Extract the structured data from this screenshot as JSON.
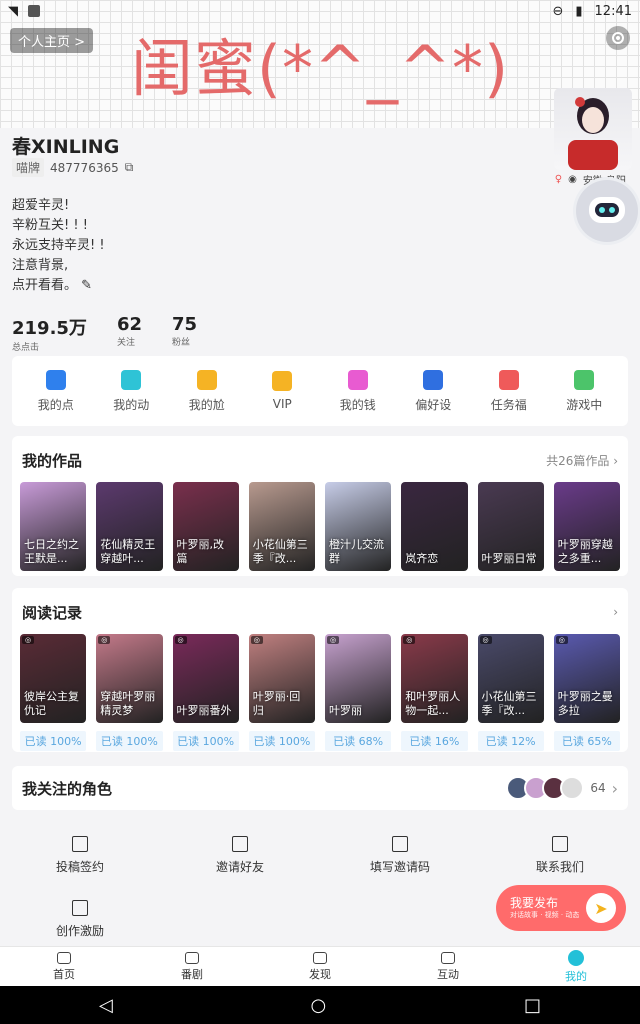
{
  "status": {
    "time": "12:41"
  },
  "banner": {
    "title": "闺蜜(*^_^*)",
    "home_label": "个人主页 >"
  },
  "profile": {
    "name": "春XINLING",
    "tag": "喵牌",
    "id": "487776365",
    "location": "安徽 阜阳",
    "bio": [
      "超爱辛灵!",
      "辛粉互关! ! !",
      "永远支持辛灵! !",
      "注意背景,",
      "点开看看。"
    ]
  },
  "stats": [
    {
      "value": "219.5万",
      "label": "总点击"
    },
    {
      "value": "62",
      "label": "关注"
    },
    {
      "value": "75",
      "label": "粉丝"
    }
  ],
  "menu": [
    {
      "label": "我的点",
      "icon": "thumb-up-icon",
      "color": "#2f80ed"
    },
    {
      "label": "我的动",
      "icon": "activity-icon",
      "color": "#2ec3d6"
    },
    {
      "label": "我的尬",
      "icon": "wallet-icon",
      "color": "#f5b324"
    },
    {
      "label": "VIP",
      "icon": "crown-icon",
      "color": "#f5b324"
    },
    {
      "label": "我的钱",
      "icon": "money-icon",
      "color": "#e85bd1"
    },
    {
      "label": "偏好设",
      "icon": "preference-icon",
      "color": "#2f6fe0"
    },
    {
      "label": "任务福",
      "icon": "gift-icon",
      "color": "#ef5a5a"
    },
    {
      "label": "游戏中",
      "icon": "game-icon",
      "color": "#4cc46a"
    }
  ],
  "works": {
    "title": "我的作品",
    "count": "共26篇作品",
    "items": [
      {
        "caption": "七日之约之王默是...",
        "color": "#c89bd8"
      },
      {
        "caption": "花仙精灵王穿越叶...",
        "color": "#5c3a6e"
      },
      {
        "caption": "叶罗丽,改篇",
        "color": "#7a2f4d"
      },
      {
        "caption": "小花仙第三季『改...",
        "color": "#b89a8f"
      },
      {
        "caption": "橙汁儿交流群",
        "color": "#c7cde8"
      },
      {
        "caption": "岚齐恋",
        "color": "#3a2740"
      },
      {
        "caption": "叶罗丽日常",
        "color": "#4a3a52"
      },
      {
        "caption": "叶罗丽穿越之多重...",
        "color": "#6a3b8a"
      }
    ]
  },
  "history": {
    "title": "阅读记录",
    "items": [
      {
        "caption": "彼岸公主复仇记",
        "progress": "已读 100%",
        "color": "#5a2b36"
      },
      {
        "caption": "穿越叶罗丽精灵梦",
        "progress": "已读 100%",
        "color": "#c47a8a"
      },
      {
        "caption": "叶罗丽番外",
        "progress": "已读 100%",
        "color": "#7a2a5a"
      },
      {
        "caption": "叶罗丽·回归",
        "progress": "已读 100%",
        "color": "#c08080"
      },
      {
        "caption": "叶罗丽",
        "progress": "已读 68%",
        "color": "#c7a2cf"
      },
      {
        "caption": "和叶罗丽人物一起...",
        "progress": "已读 16%",
        "color": "#8a3a4a"
      },
      {
        "caption": "小花仙第三季『改...",
        "progress": "已读 12%",
        "color": "#4a4a6a"
      },
      {
        "caption": "叶罗丽之曼多拉",
        "progress": "已读 65%",
        "color": "#5a5ab0"
      }
    ]
  },
  "followed": {
    "title": "我关注的角色",
    "count": "64"
  },
  "footer_links": [
    {
      "label": "投稿签约",
      "icon": "bookmark-icon"
    },
    {
      "label": "邀请好友",
      "icon": "invite-icon"
    },
    {
      "label": "填写邀请码",
      "icon": "ticket-icon"
    },
    {
      "label": "联系我们",
      "icon": "contact-icon"
    },
    {
      "label": "创作激励",
      "icon": "reward-icon"
    }
  ],
  "publish": {
    "title": "我要发布",
    "subtitle": "对话故事 · 视频 · 动态"
  },
  "tabs": [
    {
      "label": "首页",
      "icon": "home-icon"
    },
    {
      "label": "番剧",
      "icon": "video-icon"
    },
    {
      "label": "发现",
      "icon": "discover-icon"
    },
    {
      "label": "互动",
      "icon": "chat-icon"
    },
    {
      "label": "我的",
      "icon": "me-icon"
    }
  ]
}
